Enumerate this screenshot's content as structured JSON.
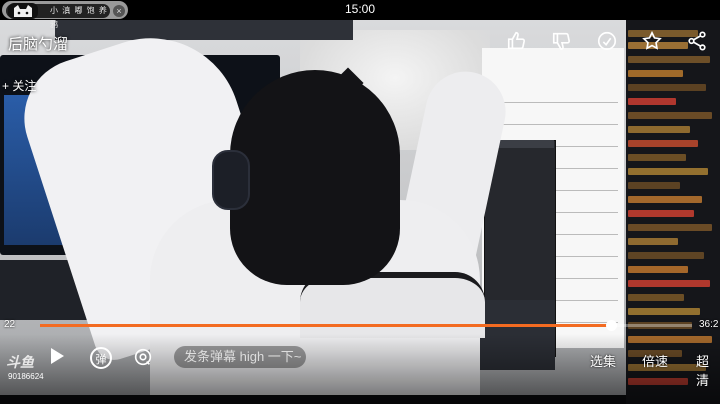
{
  "status_bar": {
    "time": "15:00"
  },
  "channel_badge": {
    "label": "小 滇 嘟 饱 养 鸦"
  },
  "video": {
    "title": "后脑勺溜",
    "follow_label": "+ 关注"
  },
  "icons": {
    "like": "thumbs-up-icon",
    "dislike": "thumbs-down-icon",
    "coin": "coin-icon",
    "favorite": "star-icon",
    "share": "share-icon",
    "danmu_toggle": "danmu-icon",
    "danmu_settings": "danmu-settings-icon"
  },
  "player": {
    "current_time": "22",
    "total_time": "36:2",
    "progress_fraction": 0.875,
    "accent_color": "#f36b21"
  },
  "controls": {
    "danmu_toggle_label": "弹",
    "danmu_placeholder": "发条弹幕 high 一下~",
    "options": [
      "选集",
      "倍速",
      "超清"
    ]
  },
  "watermark": {
    "logo": "斗鱼",
    "room": "90186624"
  }
}
